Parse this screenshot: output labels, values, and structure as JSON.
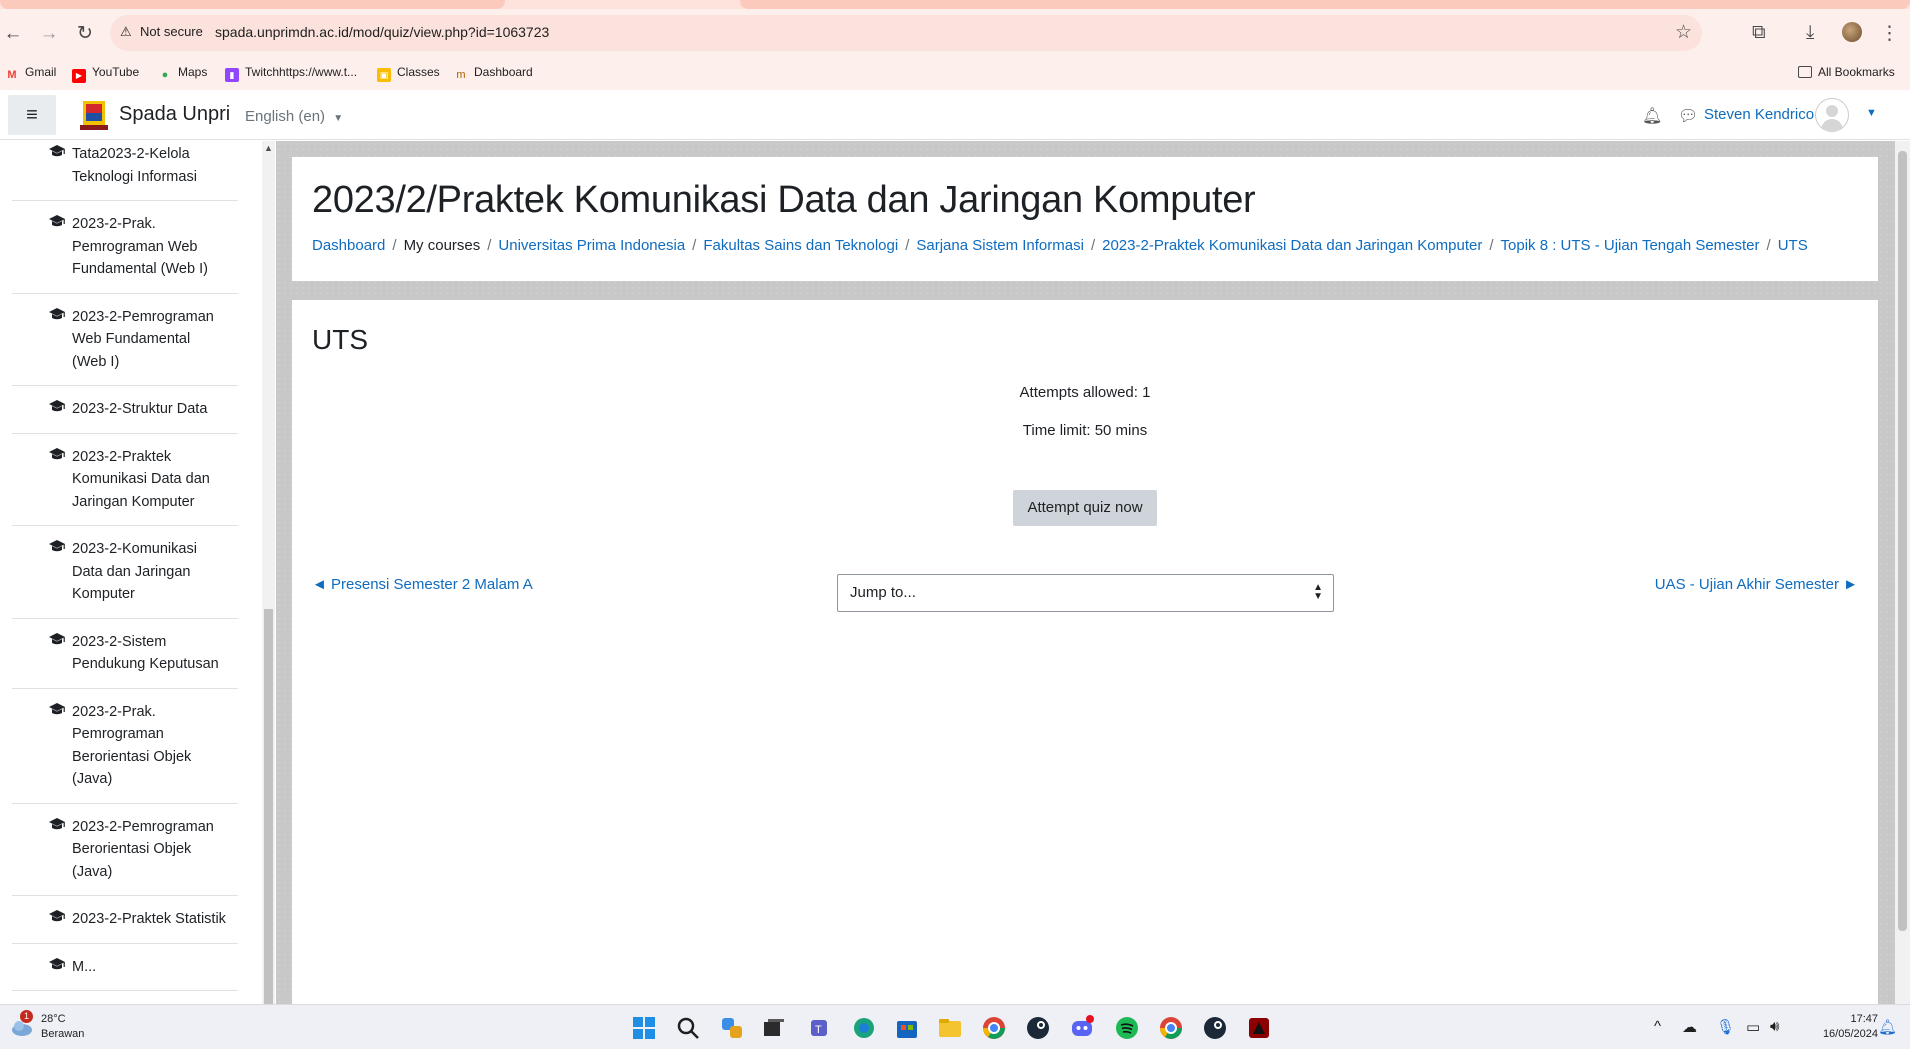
{
  "browser": {
    "not_secure_label": "Not secure",
    "url": "spada.unprimdn.ac.id/mod/quiz/view.php?id=1063723",
    "bookmarks": [
      "Gmail",
      "YouTube",
      "Maps",
      "Twitchhttps://www.t...",
      "Classes",
      "Dashboard"
    ],
    "all_bookmarks_label": "All Bookmarks"
  },
  "navbar": {
    "site_name": "Spada Unpri",
    "language": "English (en)",
    "user_name": "Steven Kendrico"
  },
  "drawer": {
    "courses": [
      "Tata2023-2-Kelola Teknologi Informasi",
      "2023-2-Prak. Pemrograman Web Fundamental (Web I)",
      "2023-2-Pemrograman Web Fundamental (Web I)",
      "2023-2-Struktur Data",
      "2023-2-Praktek Komunikasi Data dan Jaringan Komputer",
      "2023-2-Komunikasi Data dan Jaringan Komputer",
      "2023-2-Sistem Pendukung Keputusan",
      "2023-2-Prak. Pemrograman Berorientasi Objek (Java)",
      "2023-2-Pemrograman Berorientasi Objek (Java)",
      "2023-2-Praktek Statistik",
      "M..."
    ]
  },
  "header": {
    "course_title": "2023/2/Praktek Komunikasi Data dan Jaringan Komputer",
    "breadcrumb": [
      {
        "label": "Dashboard",
        "link": true
      },
      {
        "label": "My courses",
        "link": false
      },
      {
        "label": "Universitas Prima Indonesia",
        "link": true
      },
      {
        "label": "Fakultas Sains dan Teknologi",
        "link": true
      },
      {
        "label": "Sarjana Sistem Informasi",
        "link": true
      },
      {
        "label": "2023-2-Praktek Komunikasi Data dan Jaringan Komputer",
        "link": true
      },
      {
        "label": "Topik 8 : UTS - Ujian Tengah Semester",
        "link": true
      },
      {
        "label": "UTS",
        "link": true
      }
    ]
  },
  "quiz": {
    "name": "UTS",
    "attempts_allowed": "Attempts allowed: 1",
    "time_limit": "Time limit: 50 mins",
    "attempt_button": "Attempt quiz now",
    "prev_activity": "◄ Presensi Semester 2 Malam A",
    "next_activity": "UAS - Ujian Akhir Semester ►",
    "jump_placeholder": "Jump to..."
  },
  "taskbar": {
    "weather_temp": "28°C",
    "weather_desc": "Berawan",
    "notification_count": "1",
    "time": "17:47",
    "date": "16/05/2024"
  },
  "colors": {
    "link": "#0f6cbf",
    "page_background": "#c8c8c8",
    "browser_chrome": "#fdf0ec"
  }
}
